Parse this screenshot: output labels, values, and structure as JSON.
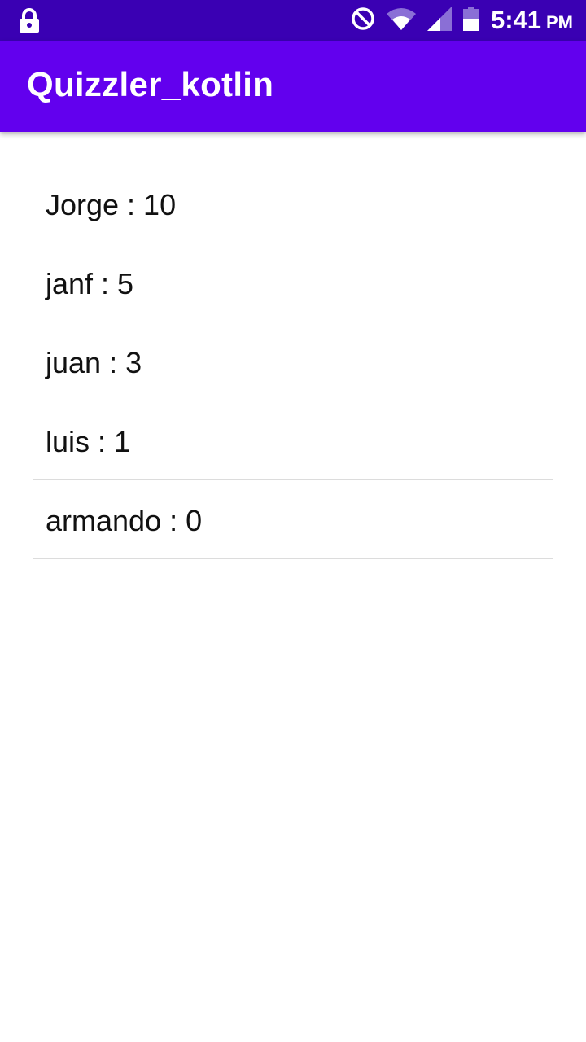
{
  "status_bar": {
    "time": "5:41",
    "ampm": "PM",
    "icons": [
      "lock-icon",
      "do-not-disturb-icon",
      "wifi-icon",
      "cell-signal-icon",
      "battery-icon"
    ],
    "background": "#3a00b3"
  },
  "app_bar": {
    "title": "Quizzler_kotlin",
    "background": "#6200ee"
  },
  "scores": [
    {
      "text": "Jorge : 10"
    },
    {
      "text": "janf : 5"
    },
    {
      "text": "juan : 3"
    },
    {
      "text": "luis : 1"
    },
    {
      "text": "armando : 0"
    }
  ]
}
